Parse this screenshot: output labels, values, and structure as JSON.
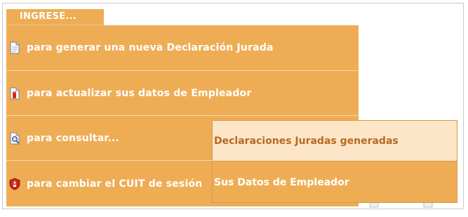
{
  "header": {
    "label": "INGRESE..."
  },
  "menu": {
    "items": [
      {
        "label": "para generar una nueva Declaración Jurada",
        "icon": "document-icon"
      },
      {
        "label": "para actualizar sus datos de Empleador",
        "icon": "edit-document-icon"
      },
      {
        "label": "para consultar...",
        "icon": "search-document-icon"
      },
      {
        "label": "para cambiar el CUIT de sesión",
        "icon": "shield-icon"
      }
    ]
  },
  "submenu": {
    "items": [
      {
        "label": "Declaraciones Juradas generadas",
        "highlighted": true
      },
      {
        "label": "Sus Datos de Empleador",
        "highlighted": false
      }
    ]
  },
  "colors": {
    "menu_bg": "#eead55",
    "highlight_bg": "#fde5c8",
    "highlight_text": "#b66a22",
    "text": "#ffffff"
  }
}
